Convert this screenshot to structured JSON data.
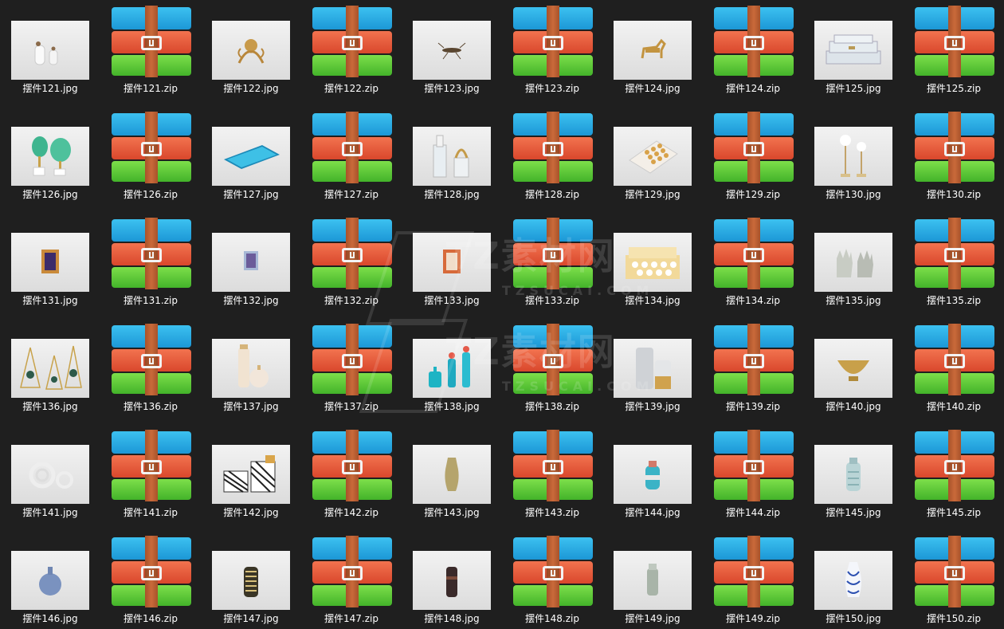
{
  "files": [
    {
      "name": "摆件121.jpg",
      "type": "image",
      "thumb": "vases-white"
    },
    {
      "name": "摆件121.zip",
      "type": "zip"
    },
    {
      "name": "摆件122.jpg",
      "type": "image",
      "thumb": "gold-octopus"
    },
    {
      "name": "摆件122.zip",
      "type": "zip"
    },
    {
      "name": "摆件123.jpg",
      "type": "image",
      "thumb": "insect"
    },
    {
      "name": "摆件123.zip",
      "type": "zip"
    },
    {
      "name": "摆件124.jpg",
      "type": "image",
      "thumb": "gold-horse"
    },
    {
      "name": "摆件124.zip",
      "type": "zip"
    },
    {
      "name": "摆件125.jpg",
      "type": "image",
      "thumb": "boxes"
    },
    {
      "name": "摆件125.zip",
      "type": "zip"
    },
    {
      "name": "摆件126.jpg",
      "type": "image",
      "thumb": "green-stone"
    },
    {
      "name": "摆件126.zip",
      "type": "zip"
    },
    {
      "name": "摆件127.jpg",
      "type": "image",
      "thumb": "blue-tray"
    },
    {
      "name": "摆件127.zip",
      "type": "zip"
    },
    {
      "name": "摆件128.jpg",
      "type": "image",
      "thumb": "crystal"
    },
    {
      "name": "摆件128.zip",
      "type": "zip"
    },
    {
      "name": "摆件129.jpg",
      "type": "image",
      "thumb": "game-board"
    },
    {
      "name": "摆件129.zip",
      "type": "zip"
    },
    {
      "name": "摆件130.jpg",
      "type": "image",
      "thumb": "flowers"
    },
    {
      "name": "摆件130.zip",
      "type": "zip"
    },
    {
      "name": "摆件131.jpg",
      "type": "image",
      "thumb": "frame"
    },
    {
      "name": "摆件131.zip",
      "type": "zip"
    },
    {
      "name": "摆件132.jpg",
      "type": "image",
      "thumb": "frame-small"
    },
    {
      "name": "摆件132.zip",
      "type": "zip"
    },
    {
      "name": "摆件133.jpg",
      "type": "image",
      "thumb": "frame-red"
    },
    {
      "name": "摆件133.zip",
      "type": "zip"
    },
    {
      "name": "摆件134.jpg",
      "type": "image",
      "thumb": "honeycomb-box"
    },
    {
      "name": "摆件134.zip",
      "type": "zip"
    },
    {
      "name": "摆件135.jpg",
      "type": "image",
      "thumb": "hands"
    },
    {
      "name": "摆件135.zip",
      "type": "zip"
    },
    {
      "name": "摆件136.jpg",
      "type": "image",
      "thumb": "geo-stands"
    },
    {
      "name": "摆件136.zip",
      "type": "zip"
    },
    {
      "name": "摆件137.jpg",
      "type": "image",
      "thumb": "bottles-peach"
    },
    {
      "name": "摆件137.zip",
      "type": "zip"
    },
    {
      "name": "摆件138.jpg",
      "type": "image",
      "thumb": "teal-bottles"
    },
    {
      "name": "摆件138.zip",
      "type": "zip"
    },
    {
      "name": "摆件139.jpg",
      "type": "image",
      "thumb": "marble-vases"
    },
    {
      "name": "摆件139.zip",
      "type": "zip"
    },
    {
      "name": "摆件140.jpg",
      "type": "image",
      "thumb": "gold-bowl"
    },
    {
      "name": "摆件140.zip",
      "type": "zip"
    },
    {
      "name": "摆件141.jpg",
      "type": "image",
      "thumb": "knots"
    },
    {
      "name": "摆件141.zip",
      "type": "zip"
    },
    {
      "name": "摆件142.jpg",
      "type": "image",
      "thumb": "striped-boxes"
    },
    {
      "name": "摆件142.zip",
      "type": "zip"
    },
    {
      "name": "摆件143.jpg",
      "type": "image",
      "thumb": "vase-olive"
    },
    {
      "name": "摆件143.zip",
      "type": "zip"
    },
    {
      "name": "摆件144.jpg",
      "type": "image",
      "thumb": "vase-teal"
    },
    {
      "name": "摆件144.zip",
      "type": "zip"
    },
    {
      "name": "摆件145.jpg",
      "type": "image",
      "thumb": "vase-pattern"
    },
    {
      "name": "摆件145.zip",
      "type": "zip"
    },
    {
      "name": "摆件146.jpg",
      "type": "image",
      "thumb": "vase-blue-round"
    },
    {
      "name": "摆件146.zip",
      "type": "zip"
    },
    {
      "name": "摆件147.jpg",
      "type": "image",
      "thumb": "vase-striped"
    },
    {
      "name": "摆件147.zip",
      "type": "zip"
    },
    {
      "name": "摆件148.jpg",
      "type": "image",
      "thumb": "vase-dark"
    },
    {
      "name": "摆件148.zip",
      "type": "zip"
    },
    {
      "name": "摆件149.jpg",
      "type": "image",
      "thumb": "vase-gray"
    },
    {
      "name": "摆件149.zip",
      "type": "zip"
    },
    {
      "name": "摆件150.jpg",
      "type": "image",
      "thumb": "vase-blue-white"
    },
    {
      "name": "摆件150.zip",
      "type": "zip"
    }
  ],
  "watermark": {
    "brand": "TZ素材网",
    "url": "TZSUCAI.COM"
  },
  "colors": {
    "background": "#1f1f1f",
    "label": "#ffffff",
    "zip_blue": "#1c97d6",
    "zip_red": "#d9472c",
    "zip_green": "#43b32a",
    "zip_strap": "#a8522a"
  }
}
